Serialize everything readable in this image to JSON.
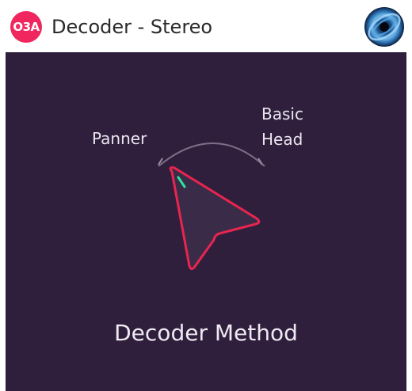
{
  "header": {
    "badge": "O3A",
    "title": "Decoder - Stereo",
    "logo_icon": "blackhole-logo-icon"
  },
  "control": {
    "options": [
      "Panner",
      "Basic Head"
    ],
    "option_left": "Panner",
    "option_right_line1": "Basic",
    "option_right_line2": "Head",
    "selected": "Panner",
    "label": "Decoder Method"
  },
  "colors": {
    "accent": "#f0265e",
    "panel_bg": "#2f1f3d",
    "indicator": "#2fe0a0"
  }
}
